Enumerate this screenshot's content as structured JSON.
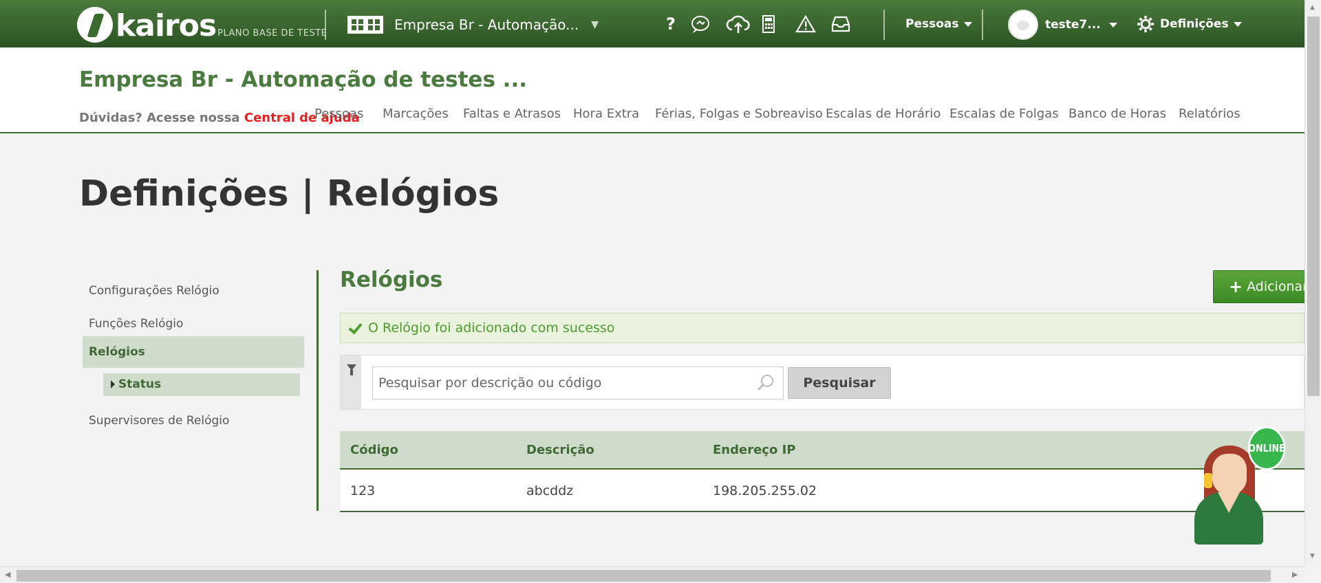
{
  "topbar": {
    "logo_text": "kairos",
    "plan_label": "PLANO BASE DE TESTE",
    "company_selector": "Empresa Br - Automação...",
    "people_menu": "Pessoas",
    "user_name": "teste7...",
    "settings_menu": "Definições",
    "icons": [
      "help-icon",
      "chat-icon",
      "cloud-upload-icon",
      "calculator-icon",
      "warning-icon",
      "inbox-icon"
    ]
  },
  "header": {
    "company_title": "Empresa Br - Automação de testes ...",
    "help_prefix": "Dúvidas? Acesse nossa ",
    "help_link": "Central de ajuda",
    "nav": [
      "Pessoas",
      "Marcações",
      "Faltas e Atrasos",
      "Hora Extra",
      "Férias, Folgas e Sobreaviso",
      "Escalas de Horário",
      "Escalas de Folgas",
      "Banco de Horas",
      "Relatórios"
    ]
  },
  "page_title": "Definições | Relógios",
  "sidebar": {
    "items": [
      "Configurações Relógio",
      "Funções Relógio",
      "Relógios",
      "Supervisores de Relógio"
    ],
    "active_item": "Relógios",
    "sub_item": "Status"
  },
  "content": {
    "title": "Relógios",
    "add_button": "Adicionar",
    "alert": "O Relógio foi adicionado com sucesso",
    "search_placeholder": "Pesquisar por descrição ou código",
    "search_button": "Pesquisar",
    "table": {
      "headers": [
        "Código",
        "Descrição",
        "Endereço IP"
      ],
      "rows": [
        [
          "123",
          "abcddz",
          "198.205.255.02"
        ]
      ]
    }
  },
  "agent": {
    "badge": "ONLINE"
  },
  "colors": {
    "brand_green": "#3d6b33",
    "title_green": "#4a7a3d",
    "help_red": "#e81e1e",
    "success_text": "#4d9a2d"
  }
}
